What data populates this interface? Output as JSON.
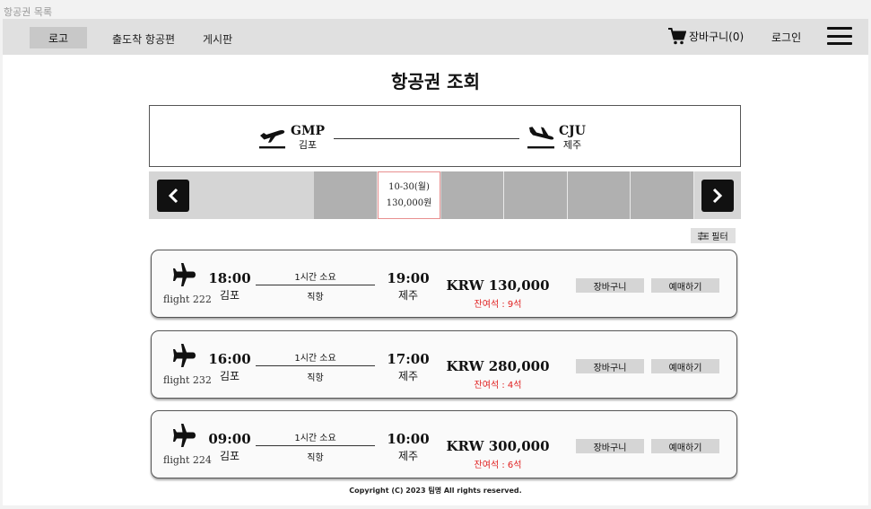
{
  "window": {
    "title": "항공권 목록"
  },
  "nav": {
    "logo": "로고",
    "links": [
      "출도착 항공편",
      "게시판"
    ],
    "cart_label": "장바구니(0)",
    "login": "로그인",
    "icons": {
      "cart": "shopping-cart-icon",
      "menu": "hamburger-menu-icon"
    }
  },
  "page": {
    "title": "항공권 조회"
  },
  "route": {
    "departure": {
      "code": "GMP",
      "name": "김포"
    },
    "arrival": {
      "code": "CJU",
      "name": "제주"
    }
  },
  "date_selector": {
    "selected_date": "10-30(월)",
    "selected_price": "130,000원",
    "icons": {
      "prev": "chevron-left-icon",
      "next": "chevron-right-icon"
    }
  },
  "filter": {
    "label": "필터",
    "icon": "filter-icon"
  },
  "flights": [
    {
      "flight_no": "flight 222",
      "dep_time": "18:00",
      "dep_city": "김포",
      "duration": "1시간 소요",
      "type": "직항",
      "arr_time": "19:00",
      "arr_city": "제주",
      "price": "KRW 130,000",
      "seats": "잔여석 : 9석",
      "cart": "장바구니",
      "book": "예매하기"
    },
    {
      "flight_no": "flight 232",
      "dep_time": "16:00",
      "dep_city": "김포",
      "duration": "1시간 소요",
      "type": "직항",
      "arr_time": "17:00",
      "arr_city": "제주",
      "price": "KRW 280,000",
      "seats": "잔여석 : 4석",
      "cart": "장바구니",
      "book": "예매하기"
    },
    {
      "flight_no": "flight 224",
      "dep_time": "09:00",
      "dep_city": "김포",
      "duration": "1시간 소요",
      "type": "직항",
      "arr_time": "10:00",
      "arr_city": "제주",
      "price": "KRW 300,000",
      "seats": "잔여석 : 6석",
      "cart": "장바구니",
      "book": "예매하기"
    }
  ],
  "footer": {
    "copyright": "Copyright (C) 2023 팀명 All rights reserved."
  },
  "colors": {
    "accent_red": "#e02020",
    "nav_bg": "#e0e0e0",
    "selected_border": "#e89090"
  }
}
